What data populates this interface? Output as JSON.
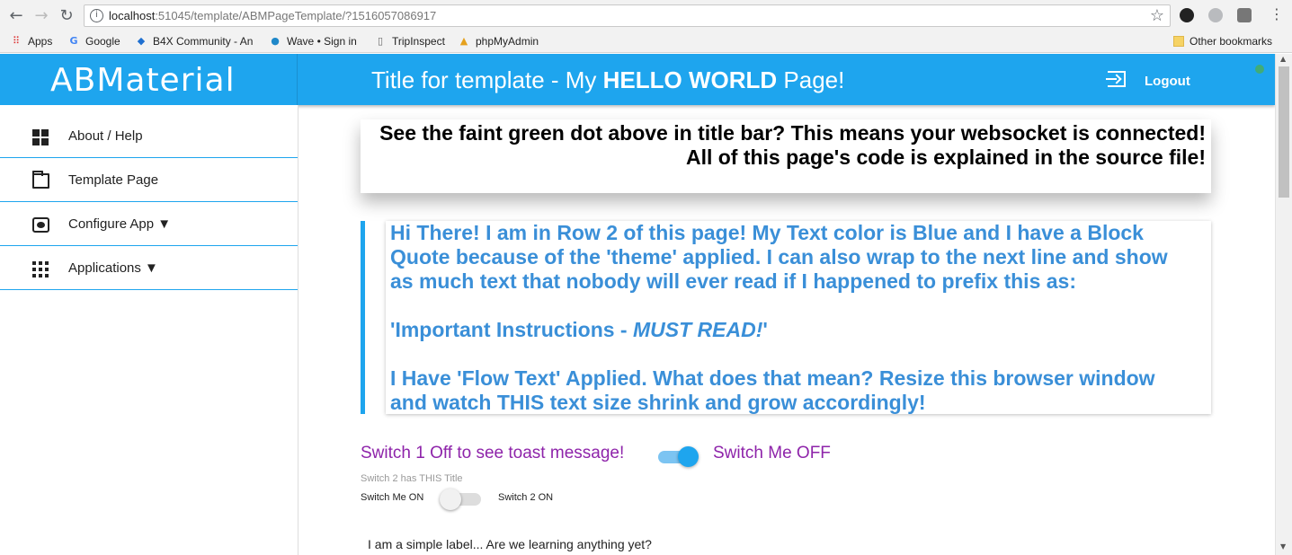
{
  "browser": {
    "url_host": "localhost",
    "url_rest": ":51045/template/ABMPageTemplate/?1516057086917",
    "back_icon": "arrow-left",
    "forward_icon": "arrow-right",
    "reload_icon": "reload",
    "bookmarks": [
      {
        "label": "Apps",
        "icon": "apps-grid-icon"
      },
      {
        "label": "Google",
        "icon": "google-icon"
      },
      {
        "label": "B4X Community - An",
        "icon": "b4x-icon"
      },
      {
        "label": "Wave • Sign in",
        "icon": "wave-icon"
      },
      {
        "label": "TripInspect",
        "icon": "page-icon"
      },
      {
        "label": "phpMyAdmin",
        "icon": "phpmyadmin-icon"
      }
    ],
    "other_bookmarks": "Other bookmarks"
  },
  "header": {
    "logo": "ABMaterial",
    "title_prefix": "Title for template - My ",
    "title_bold": "HELLO WORLD",
    "title_suffix": " Page!",
    "logout_label": "Logout",
    "accent_color": "#1ea5ee",
    "status_dot_color": "#4caf50"
  },
  "sidebar": {
    "items": [
      {
        "label": "About / Help",
        "icon": "dashboard-icon"
      },
      {
        "label": "Template Page",
        "icon": "folder-icon"
      },
      {
        "label": "Configure App ▼",
        "icon": "settings-icon"
      },
      {
        "label": "Applications ▼",
        "icon": "apps-icon"
      }
    ]
  },
  "main": {
    "card_line1": "See the faint green dot above in title bar? This means your websocket is connected!",
    "card_line2": "All of this page's code is explained in the source file!",
    "quote_line1": "Hi There! I am in Row 2 of this page! My Text color is Blue and I have a Block",
    "quote_line2": "Quote because of the 'theme' applied. I can also wrap to the next line and show",
    "quote_line3": "as much text that nobody will ever read if I happened to prefix this as:",
    "quote_line4_prefix": "'Important Instructions - ",
    "quote_line4_italic": "MUST READ!",
    "quote_line4_suffix": "'",
    "quote_line5": "I Have 'Flow Text' Applied. What does that mean? Resize this browser window",
    "quote_line6": "and watch THIS text size shrink and grow accordingly!",
    "switch1_off_label": "Switch 1 Off to see toast message!",
    "switch1_on_label": "Switch Me OFF",
    "switch1_state": "on",
    "switch2_title": "Switch 2 has THIS Title",
    "switch2_off_label": "Switch Me ON",
    "switch2_on_label": "Switch 2 ON",
    "switch2_state": "off",
    "simple_label": "I am a simple label... Are we learning anything yet?"
  }
}
